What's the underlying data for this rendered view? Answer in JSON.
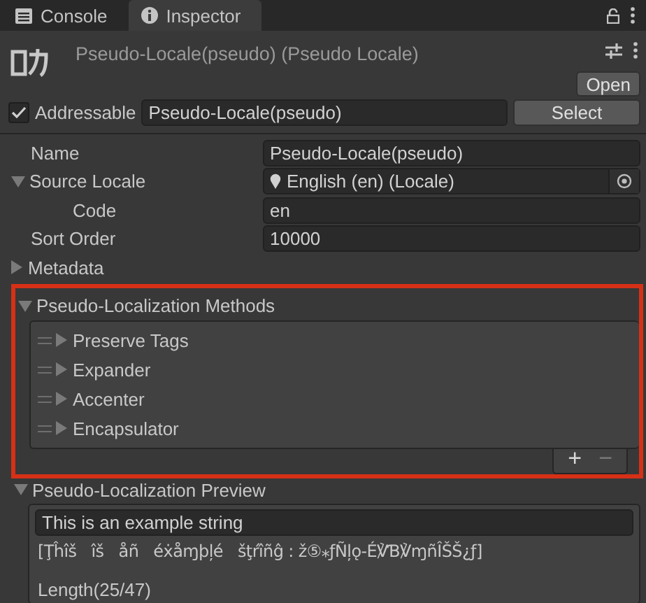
{
  "tabs": [
    {
      "label": "Console",
      "selected": false
    },
    {
      "label": "Inspector",
      "selected": true
    }
  ],
  "header": {
    "title": "Pseudo-Locale(pseudo) (Pseudo Locale)",
    "open_button": "Open"
  },
  "addressable": {
    "label": "Addressable",
    "checked": true,
    "value": "Pseudo-Locale(pseudo)",
    "select_button": "Select"
  },
  "properties": [
    {
      "kind": "text",
      "label": "Name",
      "value": "Pseudo-Locale(pseudo)"
    },
    {
      "kind": "object",
      "label": "Source Locale",
      "expanded": true,
      "value": "English (en) (Locale)",
      "children": [
        {
          "kind": "text",
          "label": "Code",
          "value": "en"
        }
      ]
    },
    {
      "kind": "text",
      "label": "Sort Order",
      "value": "10000"
    },
    {
      "kind": "foldout",
      "label": "Metadata",
      "expanded": false
    }
  ],
  "methods": {
    "label": "Pseudo-Localization Methods",
    "expanded": true,
    "items": [
      {
        "label": "Preserve Tags",
        "expanded": false
      },
      {
        "label": "Expander",
        "expanded": false
      },
      {
        "label": "Accenter",
        "expanded": false
      },
      {
        "label": "Encapsulator",
        "expanded": false
      }
    ],
    "add_button": "+",
    "remove_button": "−"
  },
  "preview": {
    "label": "Pseudo-Localization Preview",
    "expanded": true,
    "input": "This is an example string",
    "output": "[Ţĥîš   îš   åñ   éẋåɱþļé   šţŕîñĝ : ž⑤⁎ƒÑļǫ-É℣Ɓ℣ɱñÎŠŠ¿ƒ]",
    "length": "Length(25/47)"
  }
}
